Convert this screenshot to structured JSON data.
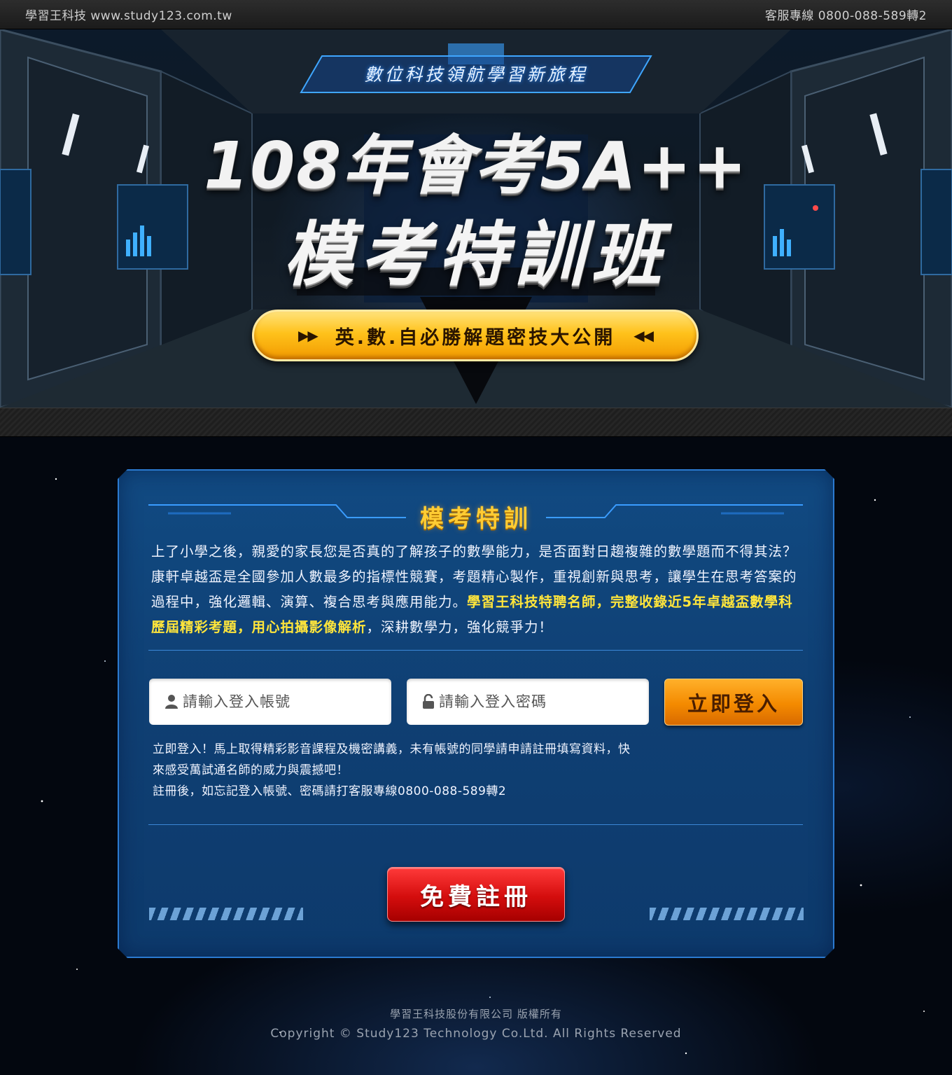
{
  "topbar": {
    "brand": "學習王科技 www.study123.com.tw",
    "hotline": "客服專線 0800-088-589轉2"
  },
  "hero": {
    "tagline": "數位科技領航學習新旅程",
    "title_line1": "108年會考5A++",
    "title_line2": "模考特訓班",
    "cta_label": "英.數.自必勝解題密技大公開",
    "cta_arrows_left": "▶▶",
    "cta_arrows_right": "◀◀"
  },
  "panel": {
    "title": "模考特訓",
    "description_plain_1": "上了小學之後，親愛的家長您是否真的了解孩子的數學能力，是否面對日趨複雜的數學題而不得其法？康軒卓越盃是全國參加人數最多的指標性競賽，考題精心製作，重視創新與思考，讓學生在思考答案的過程中，強化邏輯、演算、複合思考與應用能力。",
    "description_highlight": "學習王科技特聘名師，完整收錄近5年卓越盃數學科歷屆精彩考題，用心拍攝影像解析",
    "description_plain_2": "，深耕數學力，強化競爭力！",
    "username_placeholder": "請輸入登入帳號",
    "password_placeholder": "請輸入登入密碼",
    "login_label": "立即登入",
    "note_line1": "立即登入！馬上取得精彩影音課程及機密講義，未有帳號的同學請申請註冊填寫資料，快",
    "note_line2": "來感受萬試通名師的威力與震撼吧！",
    "note_line3": "註冊後，如忘記登入帳號、密碼請打客服專線0800-088-589轉2",
    "register_label": "免費註冊",
    "icons": {
      "user": "user-icon",
      "lock": "lock-icon"
    }
  },
  "footer": {
    "company": "學習王科技股份有限公司 版權所有",
    "copyright": "Copyright © Study123 Technology Co.Ltd. All Rights Reserved"
  },
  "colors": {
    "accent_gold": "#ffcc33",
    "highlight_yellow": "#ffe53b",
    "login_orange": "#f48a00",
    "register_red": "#d40d0d",
    "panel_blue": "#0f3f73"
  }
}
